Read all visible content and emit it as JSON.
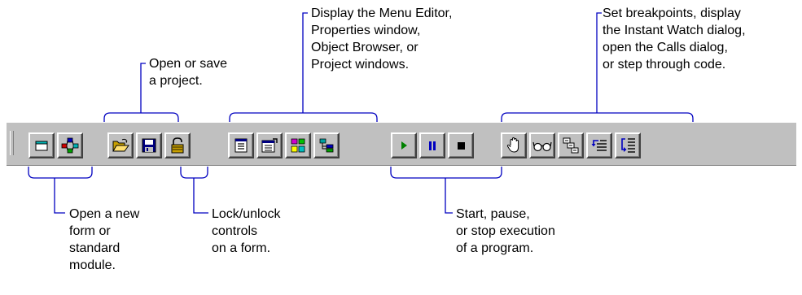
{
  "callouts": {
    "open_save": "Open or save\na project.",
    "windows": "Display the Menu Editor,\nProperties window,\nObject Browser, or\nProject windows.",
    "debug": "Set breakpoints, display\nthe Instant Watch dialog,\nopen the Calls dialog,\nor step through code.",
    "new_form": "Open a new\nform or\nstandard\nmodule.",
    "lock": "Lock/unlock\ncontrols\non a form.",
    "run": "Start, pause,\nor stop execution\nof a program."
  },
  "toolbar": {
    "buttons": [
      {
        "name": "new-form-button",
        "icon": "form-icon"
      },
      {
        "name": "new-module-button",
        "icon": "module-icon"
      },
      {
        "name": "open-project-button",
        "icon": "open-folder-icon"
      },
      {
        "name": "save-project-button",
        "icon": "floppy-disk-icon"
      },
      {
        "name": "lock-controls-button",
        "icon": "padlock-icon"
      },
      {
        "name": "menu-editor-button",
        "icon": "menu-editor-icon"
      },
      {
        "name": "properties-window-button",
        "icon": "properties-icon"
      },
      {
        "name": "object-browser-button",
        "icon": "object-browser-icon"
      },
      {
        "name": "project-window-button",
        "icon": "project-window-icon"
      },
      {
        "name": "start-button",
        "icon": "play-icon"
      },
      {
        "name": "pause-button",
        "icon": "pause-icon"
      },
      {
        "name": "stop-button",
        "icon": "stop-icon"
      },
      {
        "name": "breakpoint-button",
        "icon": "hand-icon"
      },
      {
        "name": "instant-watch-button",
        "icon": "glasses-icon"
      },
      {
        "name": "calls-button",
        "icon": "calls-icon"
      },
      {
        "name": "step-into-button",
        "icon": "step-into-icon"
      },
      {
        "name": "step-over-button",
        "icon": "step-over-icon"
      }
    ]
  },
  "colors": {
    "toolbar_face": "#c0c0c0",
    "leader_lines": "#0000c0",
    "play_green": "#008000",
    "pause_blue": "#0000c0"
  }
}
